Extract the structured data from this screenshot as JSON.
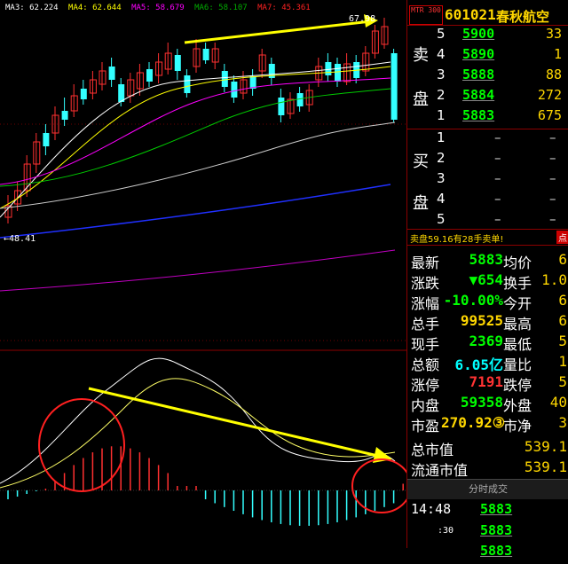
{
  "ma_legend": [
    {
      "label": "MA3: 62.224",
      "color": "#ffffff"
    },
    {
      "label": "MA4: 62.644",
      "color": "#ffff00"
    },
    {
      "label": "MA5: 58.679",
      "color": "#ff00ff"
    },
    {
      "label": "MA6: 58.107",
      "color": "#00aa00"
    },
    {
      "label": "MA7: 45.361",
      "color": "#ff2020"
    }
  ],
  "price_high_label": "67.98",
  "price_low_label": "←48.41",
  "stock": {
    "logo_text": "MTR 300",
    "code": "601021",
    "name": "春秋航空"
  },
  "order_book": {
    "sell_label_1": "卖",
    "sell_label_2": "盘",
    "buy_label_1": "买",
    "buy_label_2": "盘",
    "sells": [
      {
        "level": "5",
        "price": "5900",
        "vol": "33"
      },
      {
        "level": "4",
        "price": "5890",
        "vol": "1"
      },
      {
        "level": "3",
        "price": "5888",
        "vol": "88"
      },
      {
        "level": "2",
        "price": "5884",
        "vol": "272"
      },
      {
        "level": "1",
        "price": "5883",
        "vol": "675"
      }
    ],
    "buys": [
      {
        "level": "1",
        "dash1": "–",
        "dash2": "–"
      },
      {
        "level": "2",
        "dash1": "–",
        "dash2": "–"
      },
      {
        "level": "3",
        "dash1": "–",
        "dash2": "–"
      },
      {
        "level": "4",
        "dash1": "–",
        "dash2": "–"
      },
      {
        "level": "5",
        "dash1": "–",
        "dash2": "–"
      }
    ]
  },
  "note": "卖盘59.16有28手卖单!",
  "note_button": "点",
  "quote": [
    {
      "l": "最新",
      "v": "5883",
      "vc": "#00ff00",
      "l2": "均价",
      "v2": "6"
    },
    {
      "l": "涨跌",
      "v": "▼654",
      "vc": "#00ff00",
      "l2": "换手",
      "v2": "1.0"
    },
    {
      "l": "涨幅",
      "v": "-10.00%",
      "vc": "#00ff00",
      "l2": "今开",
      "v2": "6"
    },
    {
      "l": "总手",
      "v": "99525",
      "vc": "#ffd700",
      "l2": "最高",
      "v2": "6"
    },
    {
      "l": "现手",
      "v": "2369",
      "vc": "#00ff00",
      "l2": "最低",
      "v2": "5"
    },
    {
      "l": "总额",
      "v": "6.05亿",
      "vc": "#00ffff",
      "l2": "量比",
      "v2": "1"
    },
    {
      "l": "涨停",
      "v": "7191",
      "vc": "#ff3333",
      "l2": "跌停",
      "v2": "5"
    },
    {
      "l": "内盘",
      "v": "59358",
      "vc": "#00ff00",
      "l2": "外盘",
      "v2": "40"
    },
    {
      "l": "市盈",
      "v": "270.92③",
      "vc": "#ffd700",
      "l2": "市净",
      "v2": "3"
    }
  ],
  "cap": [
    {
      "l": "总市值",
      "v": "539.1"
    },
    {
      "l": "流通市值",
      "v": "539.1"
    }
  ],
  "tab_label": "分时成交",
  "ticks": [
    {
      "t": "14:48",
      "p": "5883"
    },
    {
      "t": ":30",
      "p": "5883"
    },
    {
      "t": "",
      "p": "5883"
    }
  ]
}
